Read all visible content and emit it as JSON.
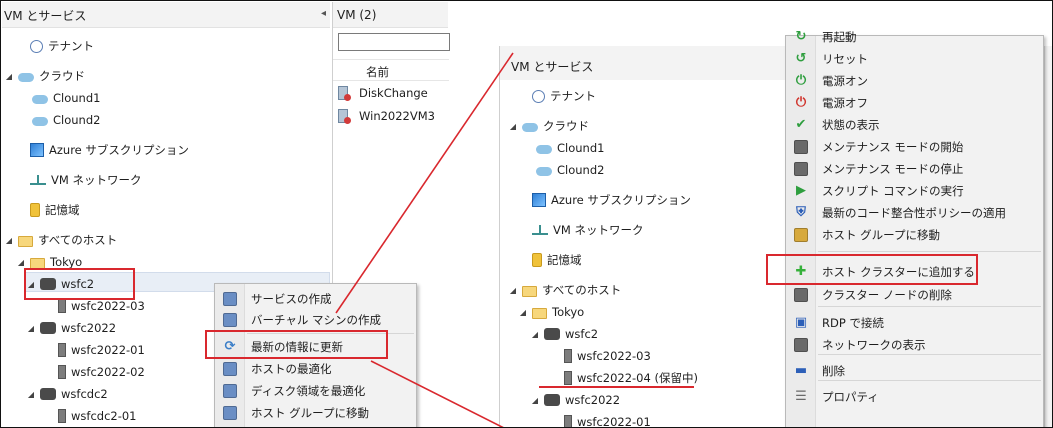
{
  "left": {
    "pane_title": "VM とサービス",
    "collapse_glyph": "◂",
    "tree": [
      {
        "label": "テナント",
        "icon": "tenant-icon",
        "expander": ""
      },
      {
        "label": "クラウド",
        "icon": "cloud-icon",
        "expander": "◢"
      },
      {
        "label": "Clound1",
        "icon": "cloud-icon",
        "expander": ""
      },
      {
        "label": "Clound2",
        "icon": "cloud-icon",
        "expander": ""
      },
      {
        "label": "Azure サブスクリプション",
        "icon": "azure-subscription-icon",
        "expander": ""
      },
      {
        "label": "VM ネットワーク",
        "icon": "network-icon",
        "expander": ""
      },
      {
        "label": "記憶域",
        "icon": "storage-icon",
        "expander": ""
      },
      {
        "label": "すべてのホスト",
        "icon": "folder-icon",
        "expander": "◢"
      },
      {
        "label": "Tokyo",
        "icon": "folder-icon",
        "expander": "◢"
      },
      {
        "label": "wsfc2",
        "icon": "cluster-icon",
        "expander": "◢"
      },
      {
        "label": "wsfc2022-03",
        "icon": "host-icon",
        "expander": ""
      },
      {
        "label": "wsfc2022",
        "icon": "cluster-icon",
        "expander": "◢"
      },
      {
        "label": "wsfc2022-01",
        "icon": "host-icon",
        "expander": ""
      },
      {
        "label": "wsfc2022-02",
        "icon": "host-icon",
        "expander": ""
      },
      {
        "label": "wsfcdc2",
        "icon": "cluster-icon",
        "expander": "◢"
      },
      {
        "label": "wsfcdc2-01",
        "icon": "host-icon",
        "expander": ""
      }
    ],
    "vm_panel": {
      "title": "VM (2)",
      "column_name": "名前",
      "rows": [
        "DiskChange",
        "Win2022VM3"
      ]
    },
    "context_menu": [
      {
        "label": "サービスの作成",
        "icon": "service-create-icon"
      },
      {
        "label": "バーチャル マシンの作成",
        "icon": "vm-create-icon"
      },
      {
        "label": "最新の情報に更新",
        "icon": "refresh-icon"
      },
      {
        "label": "ホストの最適化",
        "icon": "optimize-hosts-icon"
      },
      {
        "label": "ディスク領域を最適化",
        "icon": "optimize-disk-icon"
      },
      {
        "label": "ホスト グループに移動",
        "icon": "move-host-group-icon"
      }
    ]
  },
  "right": {
    "pane_title": "VM とサービス",
    "tree": [
      {
        "label": "テナント",
        "icon": "tenant-icon",
        "expander": ""
      },
      {
        "label": "クラウド",
        "icon": "cloud-icon",
        "expander": "◢"
      },
      {
        "label": "Clound1",
        "icon": "cloud-icon",
        "expander": ""
      },
      {
        "label": "Clound2",
        "icon": "cloud-icon",
        "expander": ""
      },
      {
        "label": "Azure サブスクリプション",
        "icon": "azure-subscription-icon",
        "expander": ""
      },
      {
        "label": "VM ネットワーク",
        "icon": "network-icon",
        "expander": ""
      },
      {
        "label": "記憶域",
        "icon": "storage-icon",
        "expander": ""
      },
      {
        "label": "すべてのホスト",
        "icon": "folder-icon",
        "expander": "◢"
      },
      {
        "label": "Tokyo",
        "icon": "folder-icon",
        "expander": "◢"
      },
      {
        "label": "wsfc2",
        "icon": "cluster-icon",
        "expander": "◢"
      },
      {
        "label": "wsfc2022-03",
        "icon": "host-icon",
        "expander": ""
      },
      {
        "label": "wsfc2022-04 (保留中)",
        "icon": "host-icon",
        "expander": ""
      },
      {
        "label": "wsfc2022",
        "icon": "cluster-icon",
        "expander": "◢"
      },
      {
        "label": "wsfc2022-01",
        "icon": "host-icon",
        "expander": ""
      }
    ],
    "context_menu": [
      {
        "label": "再起動",
        "icon": "restart-icon",
        "color": "#2e9e3e"
      },
      {
        "label": "リセット",
        "icon": "reset-icon",
        "color": "#2e9e3e"
      },
      {
        "label": "電源オン",
        "icon": "power-on-icon",
        "color": "#2e9e3e"
      },
      {
        "label": "電源オフ",
        "icon": "power-off-icon",
        "color": "#d0342c"
      },
      {
        "label": "状態の表示",
        "icon": "status-icon",
        "color": "#2e9e3e"
      },
      {
        "label": "メンテナンス モードの開始",
        "icon": "maintenance-start-icon",
        "color": "#6a6a6a"
      },
      {
        "label": "メンテナンス モードの停止",
        "icon": "maintenance-stop-icon",
        "color": "#6a6a6a"
      },
      {
        "label": "スクリプト コマンドの実行",
        "icon": "run-script-icon",
        "color": "#2e9e3e"
      },
      {
        "label": "最新のコード整合性ポリシーの適用",
        "icon": "shield-icon",
        "color": "#2c5fb8"
      },
      {
        "label": "ホスト グループに移動",
        "icon": "move-host-group-icon",
        "color": "#d7a93c"
      },
      {
        "label": "ホスト クラスターに追加する",
        "icon": "add-cluster-icon",
        "color": "#35b03a"
      },
      {
        "label": "クラスター ノードの削除",
        "icon": "remove-node-icon",
        "color": "#6a6a6a"
      },
      {
        "label": "RDP で接続",
        "icon": "rdp-icon",
        "color": "#2c5fb8"
      },
      {
        "label": "ネットワークの表示",
        "icon": "view-network-icon",
        "color": "#6a6a6a"
      },
      {
        "label": "削除",
        "icon": "delete-icon",
        "color": "#2c5fb8"
      },
      {
        "label": "プロパティ",
        "icon": "properties-icon",
        "color": "#6a6a6a"
      }
    ]
  },
  "annotation_color": "#d9282e"
}
